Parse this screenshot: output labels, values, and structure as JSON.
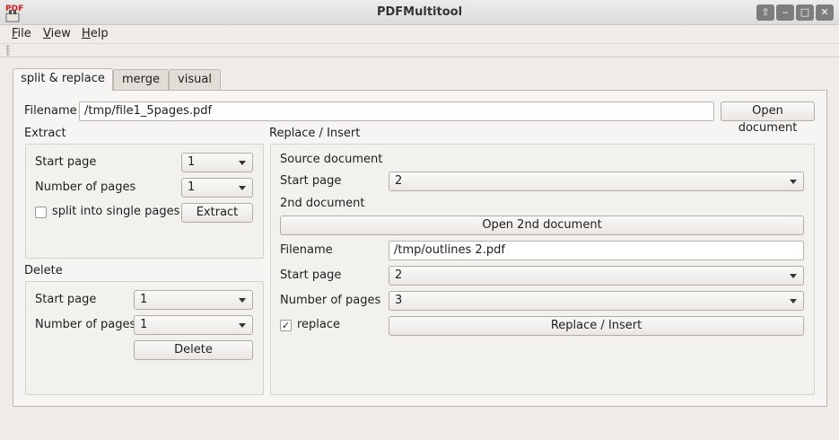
{
  "window": {
    "title": "PDFMultitool",
    "app_icon_text": "PDF"
  },
  "window_controls": {
    "up": "⇧",
    "minimize": "‒",
    "maximize": "□",
    "close": "✕"
  },
  "menu": {
    "file": "File",
    "view": "View",
    "help": "Help"
  },
  "tabs": [
    {
      "label": "split & replace",
      "active": true
    },
    {
      "label": "merge",
      "active": false
    },
    {
      "label": "visual",
      "active": false
    }
  ],
  "filename": {
    "label": "Filename",
    "value": "/tmp/file1_5pages.pdf",
    "open_button": "Open document"
  },
  "extract": {
    "title": "Extract",
    "start_page_label": "Start page",
    "start_page_value": "1",
    "num_pages_label": "Number of pages",
    "num_pages_value": "1",
    "split_label": "split into single pages",
    "split_checked": false,
    "extract_button": "Extract"
  },
  "delete": {
    "title": "Delete",
    "start_page_label": "Start page",
    "start_page_value": "1",
    "num_pages_label": "Number of pages",
    "num_pages_value": "1",
    "delete_button": "Delete"
  },
  "replace": {
    "title": "Replace / Insert",
    "source_title": "Source document",
    "start_page_label": "Start page",
    "start_page_value": "2",
    "second_title": "2nd document",
    "open_second_button": "Open 2nd document",
    "filename_label": "Filename",
    "filename_value": "/tmp/outlines 2.pdf",
    "second_start_label": "Start page",
    "second_start_value": "2",
    "num_pages_label": "Number of pages",
    "num_pages_value": "3",
    "replace_label": "replace",
    "replace_checked": true,
    "check_mark": "✓",
    "replace_button": "Replace / Insert"
  }
}
